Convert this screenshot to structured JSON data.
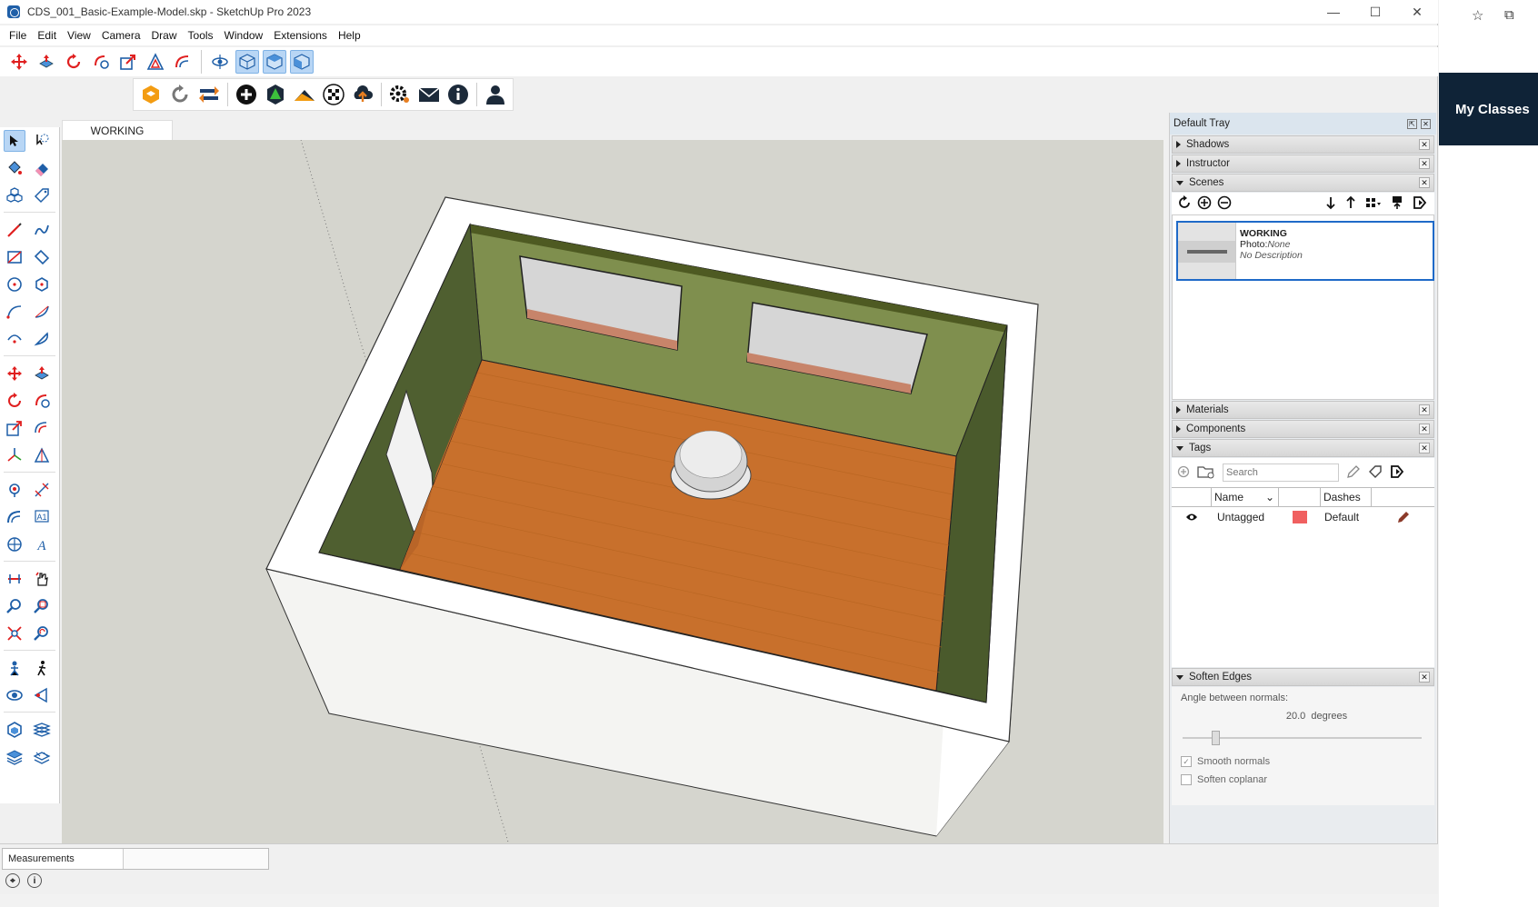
{
  "window": {
    "title": "CDS_001_Basic-Example-Model.skp - SketchUp Pro 2023",
    "minimize": "—",
    "maximize": "☐",
    "close": "✕"
  },
  "menu": [
    "File",
    "Edit",
    "View",
    "Camera",
    "Draw",
    "Tools",
    "Window",
    "Extensions",
    "Help"
  ],
  "toolbar1": {
    "icons": [
      "move-icon",
      "push-pull-icon",
      "rotate-icon",
      "follow-me-icon",
      "scale-icon",
      "offset-icon",
      "tape-icon",
      "orbit-icon",
      "iso-view-icon",
      "top-view-icon",
      "front-view-icon",
      "right-view-icon"
    ]
  },
  "toolbar2": {
    "icons": [
      "extension-warehouse-icon",
      "refresh-icon",
      "transfer-icon",
      "add-location-icon",
      "tree-icon",
      "sandbox-icon",
      "checker-icon",
      "upload-icon",
      "settings-icon",
      "mail-icon",
      "info-icon",
      "user-icon"
    ]
  },
  "scene_tab": "WORKING",
  "tray": {
    "title": "Default Tray",
    "panels": {
      "shadows": "Shadows",
      "instructor": "Instructor",
      "scenes": "Scenes",
      "materials": "Materials",
      "components": "Components",
      "tags": "Tags",
      "soften": "Soften Edges"
    },
    "scene_card": {
      "name": "WORKING",
      "photo_label": "Photo:",
      "photo_value": "None",
      "description": "No Description"
    },
    "tags": {
      "search_placeholder": "Search",
      "col_name": "Name",
      "col_dashes": "Dashes",
      "rows": [
        {
          "name": "Untagged",
          "color": "#f06060",
          "dashes": "Default"
        }
      ]
    },
    "soften_edges": {
      "angle_label": "Angle between normals:",
      "angle_value": "20.0",
      "angle_unit": "degrees",
      "smooth_label": "Smooth normals",
      "smooth_checked": true,
      "coplanar_label": "Soften coplanar",
      "coplanar_checked": false
    }
  },
  "status": {
    "measurements_label": "Measurements",
    "measurements_value": ""
  },
  "browser": {
    "my_classes": "My Classes"
  }
}
